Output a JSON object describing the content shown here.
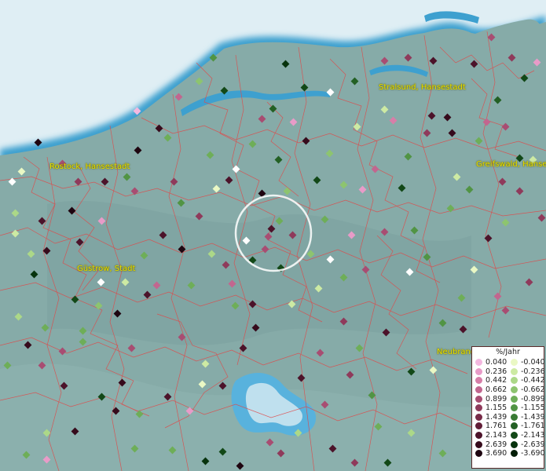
{
  "legend": {
    "title": "%/Jahr",
    "positive": [
      {
        "label": "0.040",
        "color": "#f4b8e0"
      },
      {
        "label": "0.236",
        "color": "#e89bc8"
      },
      {
        "label": "0.442",
        "color": "#d77ea8"
      },
      {
        "label": "0.662",
        "color": "#c2668f"
      },
      {
        "label": "0.899",
        "color": "#a84d72"
      },
      {
        "label": "1.155",
        "color": "#8f3a5b"
      },
      {
        "label": "1.439",
        "color": "#782b48"
      },
      {
        "label": "1.761",
        "color": "#621e38"
      },
      {
        "label": "2.143",
        "color": "#4c132a"
      },
      {
        "label": "2.639",
        "color": "#360b1c"
      },
      {
        "label": "3.690",
        "color": "#1e0510"
      }
    ],
    "negative": [
      {
        "label": "-0.040",
        "color": "#eaf8c4"
      },
      {
        "label": "-0.236",
        "color": "#cdeaa3"
      },
      {
        "label": "-0.442",
        "color": "#acd888"
      },
      {
        "label": "-0.662",
        "color": "#8dc46f"
      },
      {
        "label": "-0.899",
        "color": "#6eae58"
      },
      {
        "label": "-1.155",
        "color": "#519444"
      },
      {
        "label": "-1.439",
        "color": "#387a33"
      },
      {
        "label": "-1.761",
        "color": "#236024"
      },
      {
        "label": "-2.143",
        "color": "#124817"
      },
      {
        "label": "-2.639",
        "color": "#07330d"
      },
      {
        "label": "-3.690",
        "color": "#021d06"
      }
    ]
  },
  "cities": [
    {
      "name": "Stralsund, Hansestadt"
    },
    {
      "name": "Rostock, Hansestadt"
    },
    {
      "name": "Greifswald, Hansestadt"
    },
    {
      "name": "Güstrow, Stadt"
    },
    {
      "name": "Neubrandenburg"
    }
  ],
  "colors": {
    "sea": "#dfeef4",
    "land": "#86aba8",
    "water": "#3f9fd0",
    "border": "#e05050",
    "white_marker": "#ffffff",
    "selection_ring": "#ffffff"
  }
}
